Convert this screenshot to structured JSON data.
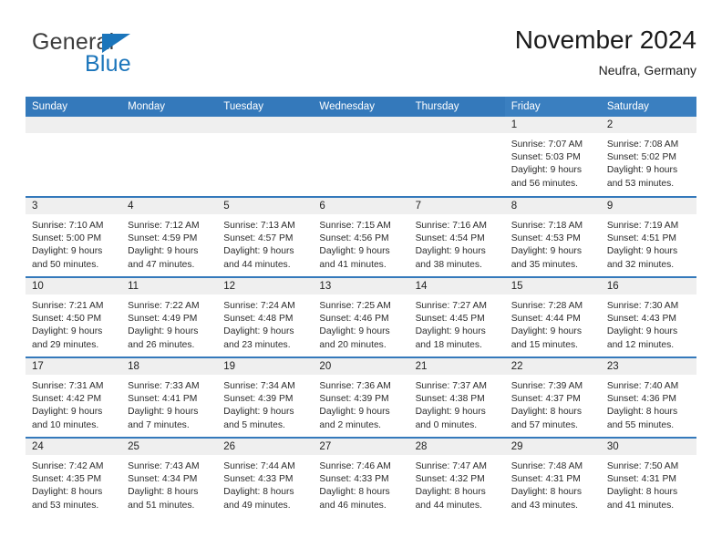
{
  "brand": {
    "name_top": "General",
    "name_bottom": "Blue",
    "triangle_icon": "triangle-logo-icon",
    "color_top": "#3c3c3c",
    "color_bottom": "#1b75bb"
  },
  "header": {
    "title": "November 2024",
    "location": "Neufra, Germany"
  },
  "theme": {
    "header_blue": "#3479bb",
    "weekend_blue": "#3a7fc0",
    "daynum_band": "#efefef",
    "text": "#222222"
  },
  "weekdays": [
    {
      "label": "Sunday",
      "weekend": false
    },
    {
      "label": "Monday",
      "weekend": false
    },
    {
      "label": "Tuesday",
      "weekend": false
    },
    {
      "label": "Wednesday",
      "weekend": false
    },
    {
      "label": "Thursday",
      "weekend": false
    },
    {
      "label": "Friday",
      "weekend": true
    },
    {
      "label": "Saturday",
      "weekend": true
    }
  ],
  "weeks": [
    [
      {
        "empty": true
      },
      {
        "empty": true
      },
      {
        "empty": true
      },
      {
        "empty": true
      },
      {
        "empty": true
      },
      {
        "day": "1",
        "sunrise": "Sunrise: 7:07 AM",
        "sunset": "Sunset: 5:03 PM",
        "daylight1": "Daylight: 9 hours",
        "daylight2": "and 56 minutes."
      },
      {
        "day": "2",
        "sunrise": "Sunrise: 7:08 AM",
        "sunset": "Sunset: 5:02 PM",
        "daylight1": "Daylight: 9 hours",
        "daylight2": "and 53 minutes."
      }
    ],
    [
      {
        "day": "3",
        "sunrise": "Sunrise: 7:10 AM",
        "sunset": "Sunset: 5:00 PM",
        "daylight1": "Daylight: 9 hours",
        "daylight2": "and 50 minutes."
      },
      {
        "day": "4",
        "sunrise": "Sunrise: 7:12 AM",
        "sunset": "Sunset: 4:59 PM",
        "daylight1": "Daylight: 9 hours",
        "daylight2": "and 47 minutes."
      },
      {
        "day": "5",
        "sunrise": "Sunrise: 7:13 AM",
        "sunset": "Sunset: 4:57 PM",
        "daylight1": "Daylight: 9 hours",
        "daylight2": "and 44 minutes."
      },
      {
        "day": "6",
        "sunrise": "Sunrise: 7:15 AM",
        "sunset": "Sunset: 4:56 PM",
        "daylight1": "Daylight: 9 hours",
        "daylight2": "and 41 minutes."
      },
      {
        "day": "7",
        "sunrise": "Sunrise: 7:16 AM",
        "sunset": "Sunset: 4:54 PM",
        "daylight1": "Daylight: 9 hours",
        "daylight2": "and 38 minutes."
      },
      {
        "day": "8",
        "sunrise": "Sunrise: 7:18 AM",
        "sunset": "Sunset: 4:53 PM",
        "daylight1": "Daylight: 9 hours",
        "daylight2": "and 35 minutes."
      },
      {
        "day": "9",
        "sunrise": "Sunrise: 7:19 AM",
        "sunset": "Sunset: 4:51 PM",
        "daylight1": "Daylight: 9 hours",
        "daylight2": "and 32 minutes."
      }
    ],
    [
      {
        "day": "10",
        "sunrise": "Sunrise: 7:21 AM",
        "sunset": "Sunset: 4:50 PM",
        "daylight1": "Daylight: 9 hours",
        "daylight2": "and 29 minutes."
      },
      {
        "day": "11",
        "sunrise": "Sunrise: 7:22 AM",
        "sunset": "Sunset: 4:49 PM",
        "daylight1": "Daylight: 9 hours",
        "daylight2": "and 26 minutes."
      },
      {
        "day": "12",
        "sunrise": "Sunrise: 7:24 AM",
        "sunset": "Sunset: 4:48 PM",
        "daylight1": "Daylight: 9 hours",
        "daylight2": "and 23 minutes."
      },
      {
        "day": "13",
        "sunrise": "Sunrise: 7:25 AM",
        "sunset": "Sunset: 4:46 PM",
        "daylight1": "Daylight: 9 hours",
        "daylight2": "and 20 minutes."
      },
      {
        "day": "14",
        "sunrise": "Sunrise: 7:27 AM",
        "sunset": "Sunset: 4:45 PM",
        "daylight1": "Daylight: 9 hours",
        "daylight2": "and 18 minutes."
      },
      {
        "day": "15",
        "sunrise": "Sunrise: 7:28 AM",
        "sunset": "Sunset: 4:44 PM",
        "daylight1": "Daylight: 9 hours",
        "daylight2": "and 15 minutes."
      },
      {
        "day": "16",
        "sunrise": "Sunrise: 7:30 AM",
        "sunset": "Sunset: 4:43 PM",
        "daylight1": "Daylight: 9 hours",
        "daylight2": "and 12 minutes."
      }
    ],
    [
      {
        "day": "17",
        "sunrise": "Sunrise: 7:31 AM",
        "sunset": "Sunset: 4:42 PM",
        "daylight1": "Daylight: 9 hours",
        "daylight2": "and 10 minutes."
      },
      {
        "day": "18",
        "sunrise": "Sunrise: 7:33 AM",
        "sunset": "Sunset: 4:41 PM",
        "daylight1": "Daylight: 9 hours",
        "daylight2": "and 7 minutes."
      },
      {
        "day": "19",
        "sunrise": "Sunrise: 7:34 AM",
        "sunset": "Sunset: 4:39 PM",
        "daylight1": "Daylight: 9 hours",
        "daylight2": "and 5 minutes."
      },
      {
        "day": "20",
        "sunrise": "Sunrise: 7:36 AM",
        "sunset": "Sunset: 4:39 PM",
        "daylight1": "Daylight: 9 hours",
        "daylight2": "and 2 minutes."
      },
      {
        "day": "21",
        "sunrise": "Sunrise: 7:37 AM",
        "sunset": "Sunset: 4:38 PM",
        "daylight1": "Daylight: 9 hours",
        "daylight2": "and 0 minutes."
      },
      {
        "day": "22",
        "sunrise": "Sunrise: 7:39 AM",
        "sunset": "Sunset: 4:37 PM",
        "daylight1": "Daylight: 8 hours",
        "daylight2": "and 57 minutes."
      },
      {
        "day": "23",
        "sunrise": "Sunrise: 7:40 AM",
        "sunset": "Sunset: 4:36 PM",
        "daylight1": "Daylight: 8 hours",
        "daylight2": "and 55 minutes."
      }
    ],
    [
      {
        "day": "24",
        "sunrise": "Sunrise: 7:42 AM",
        "sunset": "Sunset: 4:35 PM",
        "daylight1": "Daylight: 8 hours",
        "daylight2": "and 53 minutes."
      },
      {
        "day": "25",
        "sunrise": "Sunrise: 7:43 AM",
        "sunset": "Sunset: 4:34 PM",
        "daylight1": "Daylight: 8 hours",
        "daylight2": "and 51 minutes."
      },
      {
        "day": "26",
        "sunrise": "Sunrise: 7:44 AM",
        "sunset": "Sunset: 4:33 PM",
        "daylight1": "Daylight: 8 hours",
        "daylight2": "and 49 minutes."
      },
      {
        "day": "27",
        "sunrise": "Sunrise: 7:46 AM",
        "sunset": "Sunset: 4:33 PM",
        "daylight1": "Daylight: 8 hours",
        "daylight2": "and 46 minutes."
      },
      {
        "day": "28",
        "sunrise": "Sunrise: 7:47 AM",
        "sunset": "Sunset: 4:32 PM",
        "daylight1": "Daylight: 8 hours",
        "daylight2": "and 44 minutes."
      },
      {
        "day": "29",
        "sunrise": "Sunrise: 7:48 AM",
        "sunset": "Sunset: 4:31 PM",
        "daylight1": "Daylight: 8 hours",
        "daylight2": "and 43 minutes."
      },
      {
        "day": "30",
        "sunrise": "Sunrise: 7:50 AM",
        "sunset": "Sunset: 4:31 PM",
        "daylight1": "Daylight: 8 hours",
        "daylight2": "and 41 minutes."
      }
    ]
  ]
}
